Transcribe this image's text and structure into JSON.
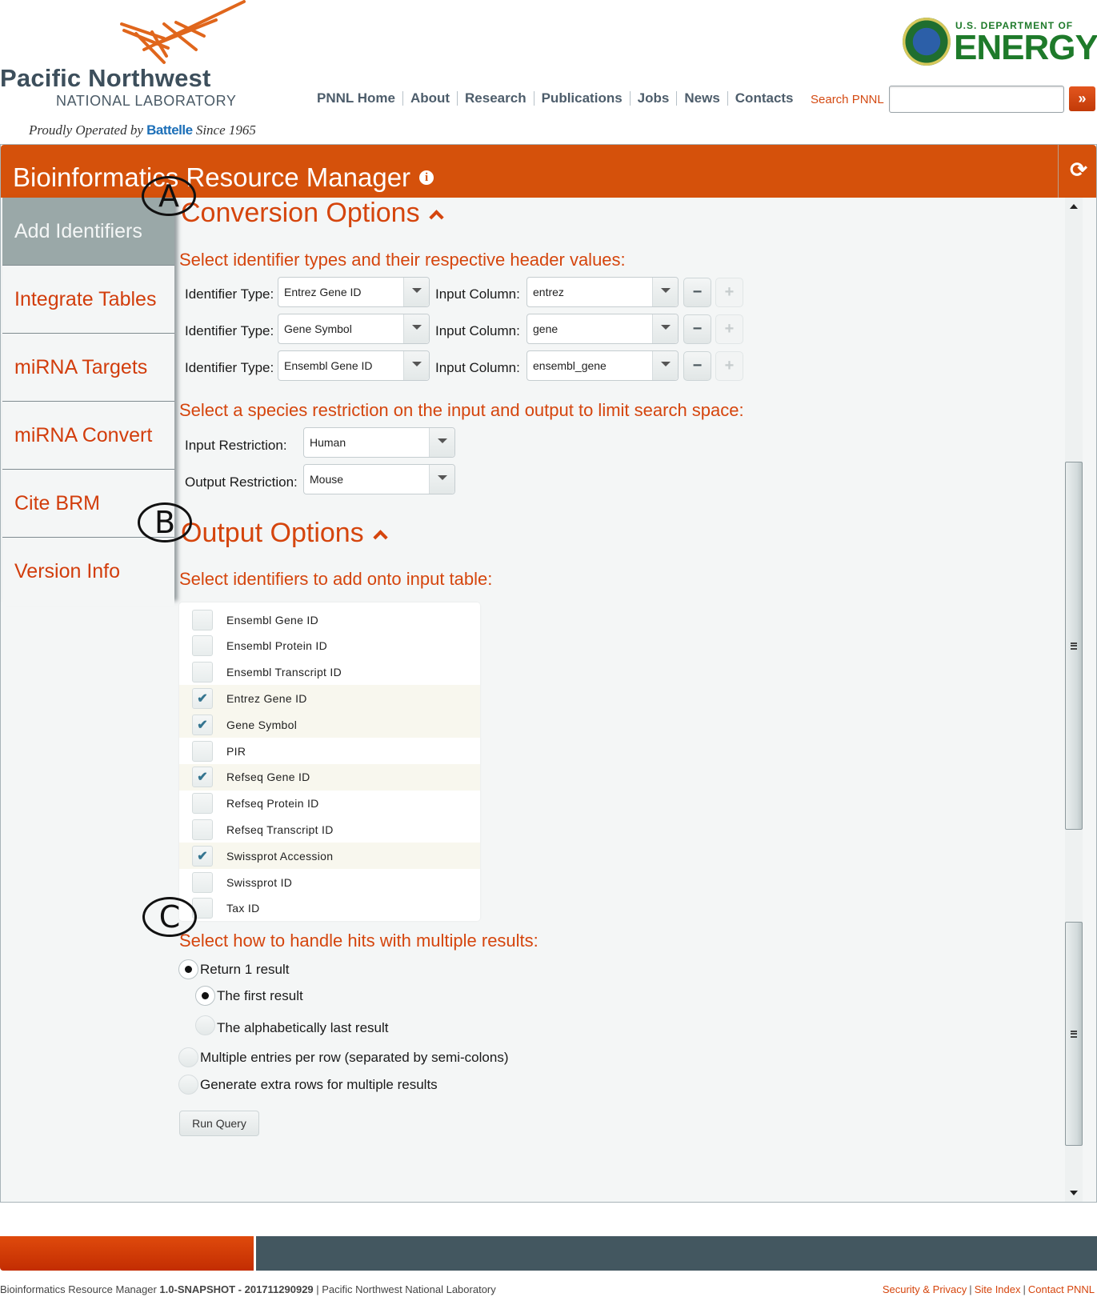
{
  "branding": {
    "lab_name_line1": "Pacific Northwest",
    "lab_name_line2": "NATIONAL LABORATORY",
    "tagline_pre": "Proudly Operated by ",
    "tagline_brand": "Battelle",
    "tagline_post": " Since 1965",
    "doe_small": "U.S. DEPARTMENT OF",
    "doe_large": "ENERGY"
  },
  "topnav": {
    "links": [
      "PNNL Home",
      "About",
      "Research",
      "Publications",
      "Jobs",
      "News",
      "Contacts"
    ],
    "search_label": "Search PNNL",
    "search_value": "",
    "search_go": "»"
  },
  "app": {
    "title": "Bioinformatics Resource Manager",
    "info_icon": "i",
    "refresh_icon": "⟳"
  },
  "sidebar": {
    "items": [
      {
        "label": "Add Identifiers",
        "active": true
      },
      {
        "label": "Integrate Tables",
        "active": false
      },
      {
        "label": "miRNA Targets",
        "active": false
      },
      {
        "label": "miRNA Convert",
        "active": false
      },
      {
        "label": "Cite BRM",
        "active": false
      },
      {
        "label": "Version Info",
        "active": false
      }
    ]
  },
  "conversion": {
    "title": "Conversion Options",
    "prompt_identifiers": "Select identifier types and their respective header values:",
    "identifier_label": "Identifier Type:",
    "column_label": "Input Column:",
    "rows": [
      {
        "identifier_type": "Entrez Gene ID",
        "input_column": "entrez"
      },
      {
        "identifier_type": "Gene Symbol",
        "input_column": "gene"
      },
      {
        "identifier_type": "Ensembl Gene ID",
        "input_column": "ensembl_gene"
      }
    ],
    "remove_label": "−",
    "add_label": "+",
    "prompt_species": "Select a species restriction on the input and output to limit search space:",
    "input_restriction_label": "Input Restriction:",
    "input_restriction": "Human",
    "output_restriction_label": "Output Restriction:",
    "output_restriction": "Mouse"
  },
  "output": {
    "title": "Output Options",
    "prompt_identifiers": "Select identifiers to add onto input table:",
    "identifiers": [
      {
        "label": "Ensembl Gene ID",
        "checked": false
      },
      {
        "label": "Ensembl Protein ID",
        "checked": false
      },
      {
        "label": "Ensembl Transcript ID",
        "checked": false
      },
      {
        "label": "Entrez Gene ID",
        "checked": true
      },
      {
        "label": "Gene Symbol",
        "checked": true
      },
      {
        "label": "PIR",
        "checked": false
      },
      {
        "label": "Refseq Gene ID",
        "checked": true
      },
      {
        "label": "Refseq Protein ID",
        "checked": false
      },
      {
        "label": "Refseq Transcript ID",
        "checked": false
      },
      {
        "label": "Swissprot Accession",
        "checked": true
      },
      {
        "label": "Swissprot ID",
        "checked": false
      },
      {
        "label": "Tax ID",
        "checked": false
      }
    ],
    "prompt_multiple": "Select how to handle hits with multiple results:",
    "options": [
      {
        "label": "Return 1 result",
        "selected": true
      },
      {
        "label": "The first result",
        "selected": true
      },
      {
        "label": "The alphabetically last result",
        "selected": false
      },
      {
        "label": "Multiple entries per row (separated by semi-colons)",
        "selected": false
      },
      {
        "label": "Generate extra rows for multiple results",
        "selected": false
      }
    ],
    "run_button": "Run Query"
  },
  "annotations": [
    "A",
    "B",
    "C"
  ],
  "footer": {
    "app_name": "Bioinformatics Resource Manager ",
    "version": "1.0-SNAPSHOT - 201711290929",
    "org": " | Pacific Northwest National Laboratory",
    "links": [
      "Security & Privacy",
      "Site Index",
      "Contact PNNL"
    ]
  },
  "colors": {
    "brand_orange": "#d5510b",
    "heading_orange": "#d5450d",
    "sidebar_active": "#9aa8a8",
    "footer_slate": "#435760",
    "doe_green": "#1e7a2a"
  }
}
